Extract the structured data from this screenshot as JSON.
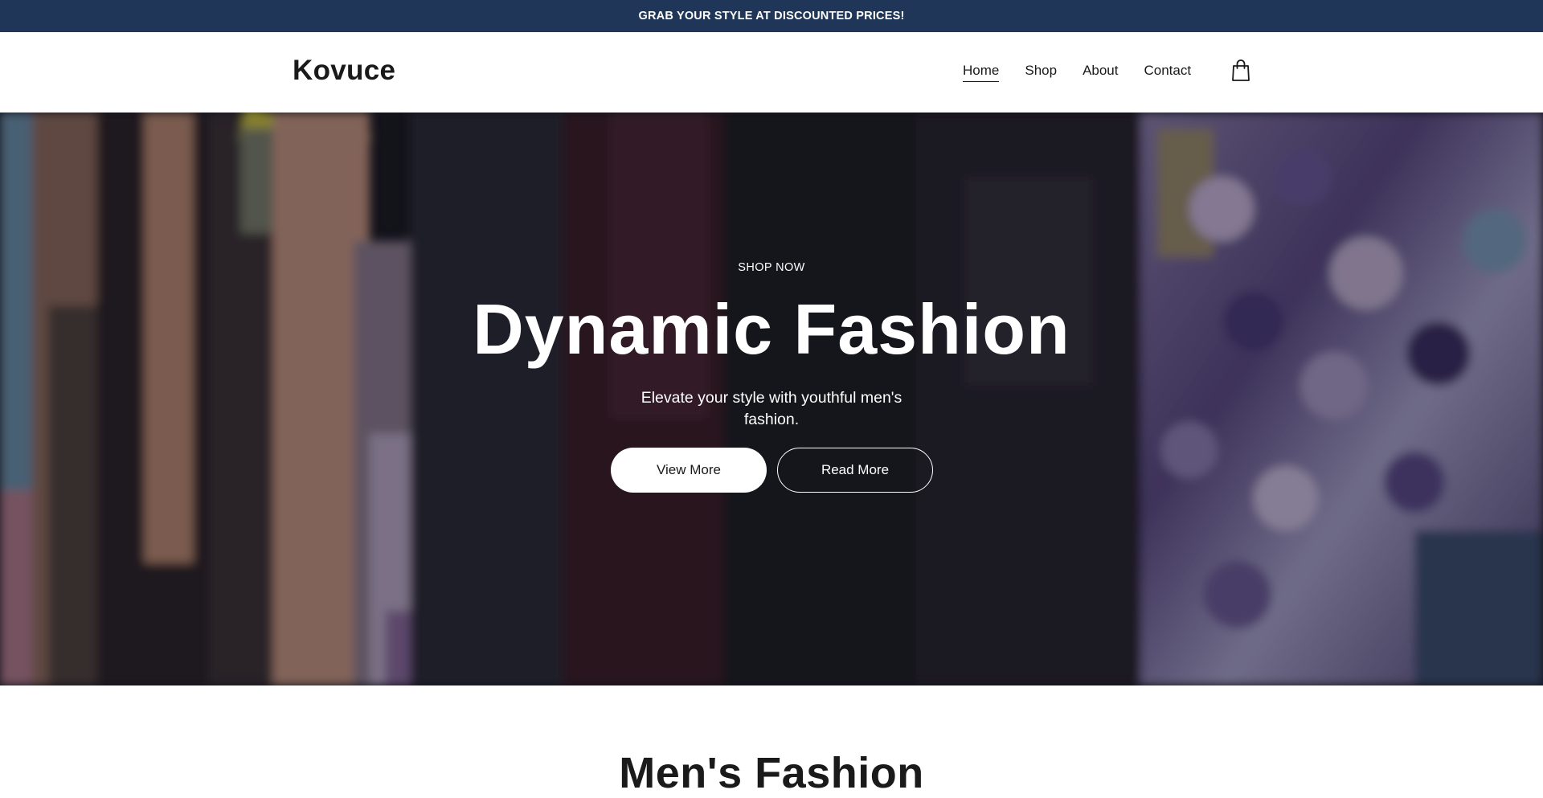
{
  "announcement": {
    "text": "GRAB YOUR STYLE AT DISCOUNTED PRICES!"
  },
  "header": {
    "logo": "Kovuce",
    "nav": [
      "Home",
      "Shop",
      "About",
      "Contact"
    ],
    "active_nav": "Home",
    "cart_icon": "shopping-bag-icon"
  },
  "hero": {
    "eyebrow": "SHOP NOW",
    "title": "Dynamic Fashion",
    "subtitle": "Elevate your style with youthful men's fashion.",
    "primary_button": "View More",
    "secondary_button": "Read More"
  },
  "section": {
    "title": "Men's Fashion"
  },
  "colors": {
    "announcement_bg": "#1f3658",
    "text": "#1a1a1a",
    "hero_text": "#ffffff"
  }
}
